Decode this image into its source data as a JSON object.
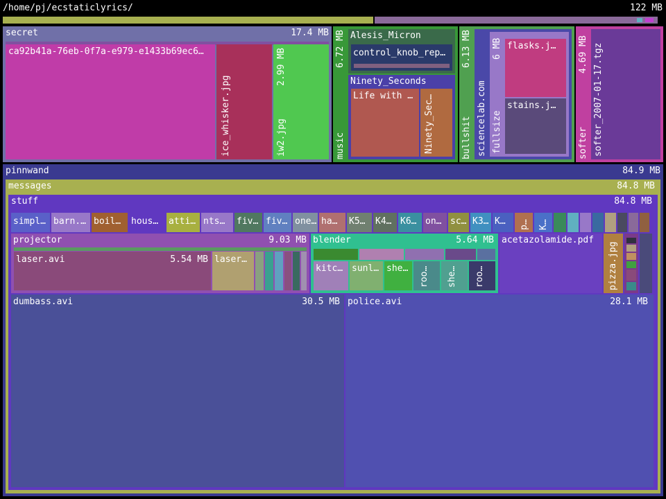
{
  "header": {
    "path": "/home/pj/ecstaticlyrics/",
    "total_size": "122 MB"
  },
  "colors": {
    "background": "#000000",
    "secret": "#7070a8",
    "pinnwand": "#3a3a90",
    "messages": "#a8b050",
    "stuff": "#6038c0",
    "music": "#389838",
    "bullshit": "#50a050",
    "softer": "#c040a0"
  },
  "tree": {
    "secret": {
      "name": "secret",
      "size": "17.4 MB",
      "hash_file": {
        "name": "ca92b41a-76eb-0f7a-e979-e1433b69ec6…"
      },
      "ice_whisker": {
        "name": "ice_whisker.jpg"
      },
      "iw2": {
        "name": "iw2.jpg",
        "size": "2.99 MB"
      }
    },
    "music": {
      "name": "music",
      "size": "6.72 MB",
      "alesis": {
        "name": "Alesis_Micron",
        "child": "control_knob_rep…"
      },
      "ninety": {
        "name": "Ninety_Seconds",
        "life": "Life with …",
        "sec": "Ninety_Sec…"
      }
    },
    "bullshit": {
      "name": "bullshit",
      "size": "6.13 MB",
      "sciencelab": {
        "name": "sciencelab.com"
      },
      "fullsize": {
        "name": "fullsize",
        "size": "6 MB",
        "flasks": "flasks.j…",
        "stains": "stains.j…"
      }
    },
    "softer": {
      "name": "softer",
      "size": "4.69 MB",
      "tgz": "softer_2007-01-17.tgz"
    },
    "pinnwand": {
      "name": "pinnwand",
      "size": "84.9 MB"
    },
    "messages": {
      "name": "messages",
      "size": "84.8 MB"
    },
    "stuff": {
      "name": "stuff",
      "size": "84.8 MB",
      "row": [
        "simpl…",
        "barn.…",
        "boil…",
        "hous…",
        "atti…",
        "nts…",
        "fiv…",
        "fiv…",
        "one…",
        "ha…",
        "K5…",
        "K4…",
        "K6…",
        "on…",
        "sc…",
        "K3…",
        "K…",
        "p…",
        "K…"
      ]
    },
    "projector": {
      "name": "projector",
      "size": "9.03 MB",
      "laser": "laser.avi",
      "laser_size": "5.54 MB",
      "laser2": "laser…"
    },
    "blender": {
      "name": "blender",
      "size": "5.64 MB",
      "kitc": "kitc…",
      "sunl": "sunl…",
      "she1": "she…",
      "roo1": "roo…",
      "she2": "she…",
      "roo2": "roo…"
    },
    "acetazolamide": {
      "name": "acetazolamide.pdf"
    },
    "pizza": {
      "name": "pizza.jpg"
    },
    "dumbass": {
      "name": "dumbass.avi",
      "size": "30.5 MB"
    },
    "police": {
      "name": "police.avi",
      "size": "28.1 MB"
    }
  }
}
